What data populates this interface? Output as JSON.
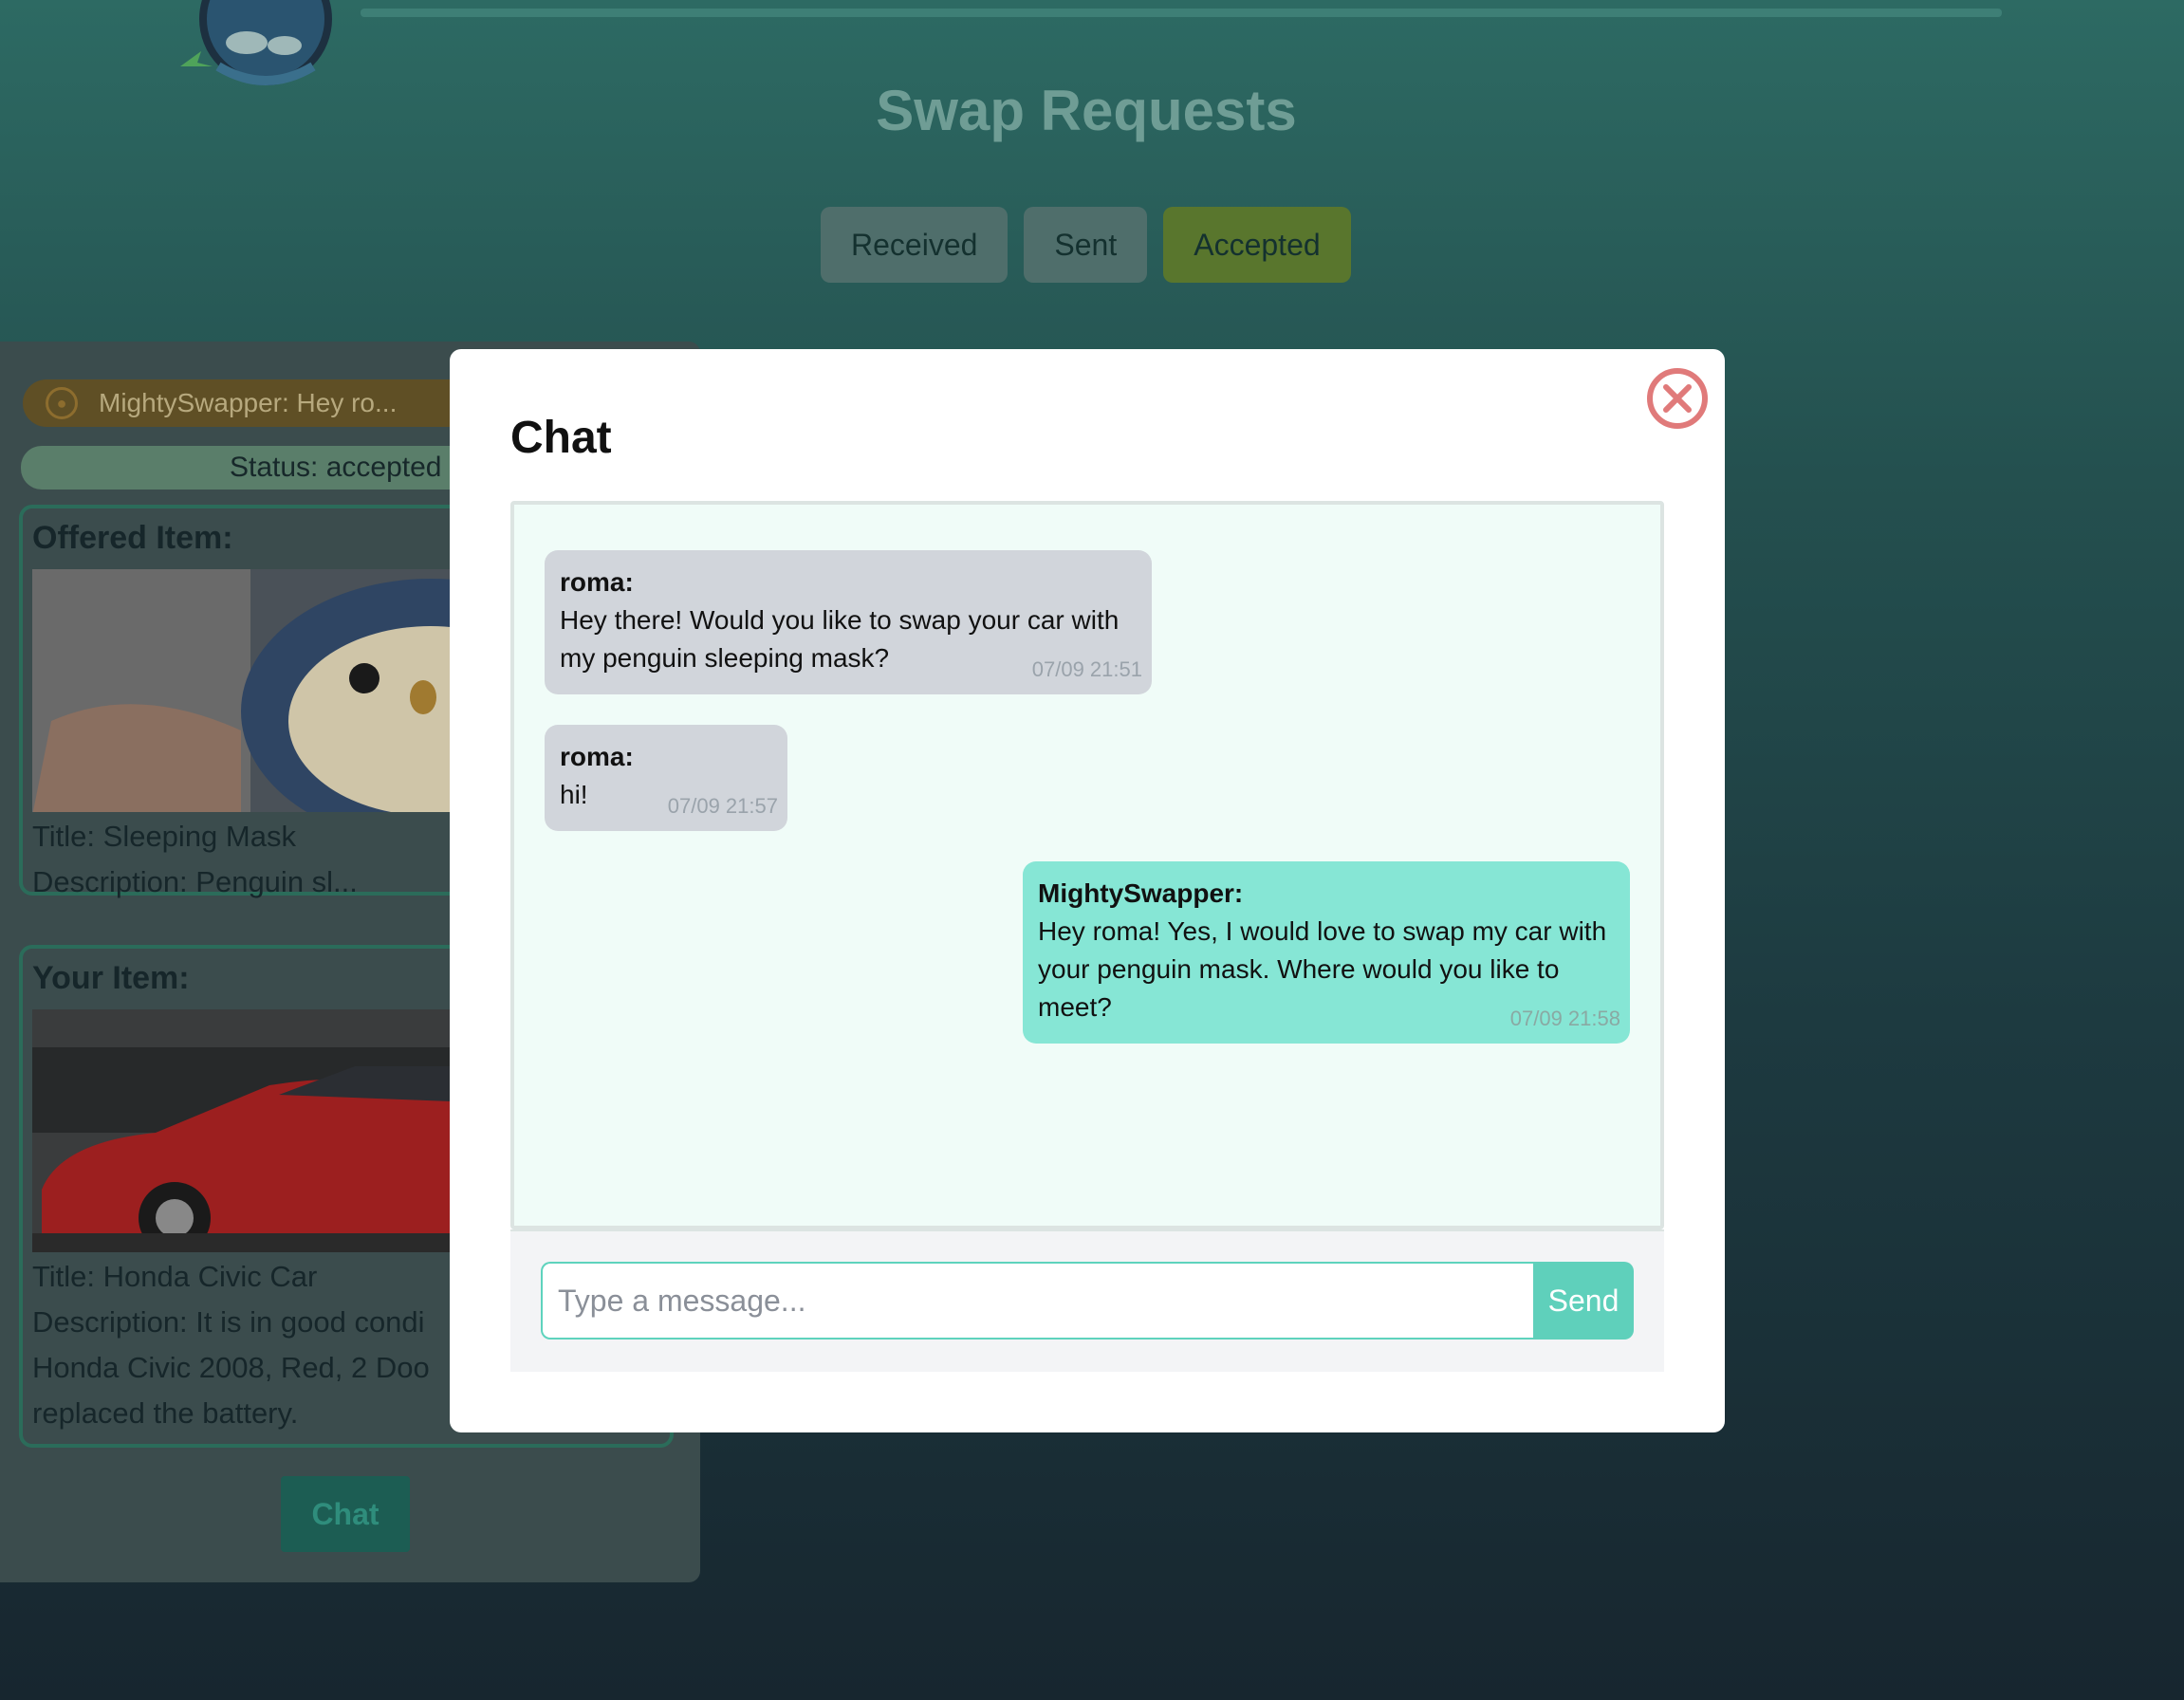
{
  "page": {
    "title": "Swap Requests",
    "tabs": [
      {
        "label": "Received"
      },
      {
        "label": "Sent"
      },
      {
        "label": "Accepted",
        "active": true
      }
    ]
  },
  "request_card": {
    "notification": "MightySwapper: Hey ro...",
    "status": "Status: accepted",
    "offered": {
      "heading": "Offered Item:",
      "title": "Title: Sleeping Mask",
      "description": "Description: Penguin sl..."
    },
    "yours": {
      "heading": "Your Item:",
      "title": "Title: Honda Civic Car",
      "description": "Description: It is in good condi",
      "description_line2": "Honda Civic 2008, Red, 2 Doo",
      "description_line3": "replaced the battery."
    },
    "chat_label": "Chat"
  },
  "chat_modal": {
    "title": "Chat",
    "messages": [
      {
        "sender": "roma:",
        "text": "Hey there! Would you like to swap your car with my penguin sleeping mask?",
        "time": "07/09 21:51",
        "own": false
      },
      {
        "sender": "roma:",
        "text": "hi!",
        "time": "07/09 21:57",
        "own": false
      },
      {
        "sender": "MightySwapper:",
        "text": "Hey roma! Yes, I would love to swap my car with your penguin mask. Where would you like to meet?",
        "time": "07/09 21:58",
        "own": true
      }
    ],
    "input_placeholder": "Type a message...",
    "send_label": "Send"
  },
  "colors": {
    "accent": "#5fd0bb",
    "own_bubble": "#86e6d5",
    "other_bubble": "#d1d5db",
    "close_icon": "#e07a7a"
  }
}
